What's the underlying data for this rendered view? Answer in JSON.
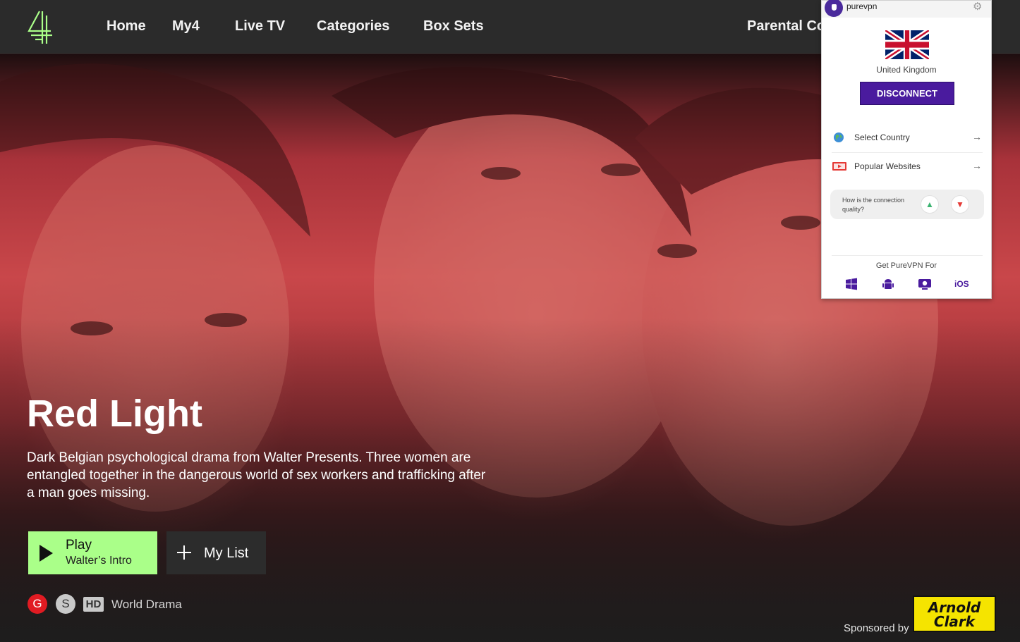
{
  "header": {
    "nav": [
      "Home",
      "My4",
      "Live TV",
      "Categories",
      "Box Sets",
      "Parental Co"
    ]
  },
  "hero": {
    "title": "Red Light",
    "description": "Dark Belgian psychological drama from Walter Presents. Three women are entangled together in the dangerous world of sex workers and trafficking after a man goes missing.",
    "play_label": "Play",
    "play_sublabel": "Walter’s Intro",
    "mylist_label": "My List",
    "rating_badge": "G",
    "subtitle_badge": "S",
    "hd_badge": "HD",
    "genre": "World Drama",
    "sponsored_text": "Sponsored by",
    "sponsor_logo_line1": "Arnold",
    "sponsor_logo_line2": "Clark"
  },
  "vpn": {
    "brand": "purevpn",
    "country": "United Kingdom",
    "disconnect_label": "DISCONNECT",
    "menu": [
      {
        "label": "Select Country",
        "icon": "globe-icon"
      },
      {
        "label": "Popular Websites",
        "icon": "video-site-icon"
      }
    ],
    "feedback_question": "How is the connection quality?",
    "get_for_label": "Get PureVPN For",
    "platforms": [
      "windows",
      "android",
      "mac",
      "iOS"
    ],
    "ios_label": "iOS"
  },
  "colors": {
    "header_bg": "#2b2b2b",
    "play_button_bg": "#aaff89",
    "mylist_button_bg": "#2c2c2c",
    "logo_green": "#aaff89",
    "vpn_accent": "#4a1b9e",
    "rating_red": "#e11b22",
    "sponsor_yellow": "#f5e400"
  }
}
